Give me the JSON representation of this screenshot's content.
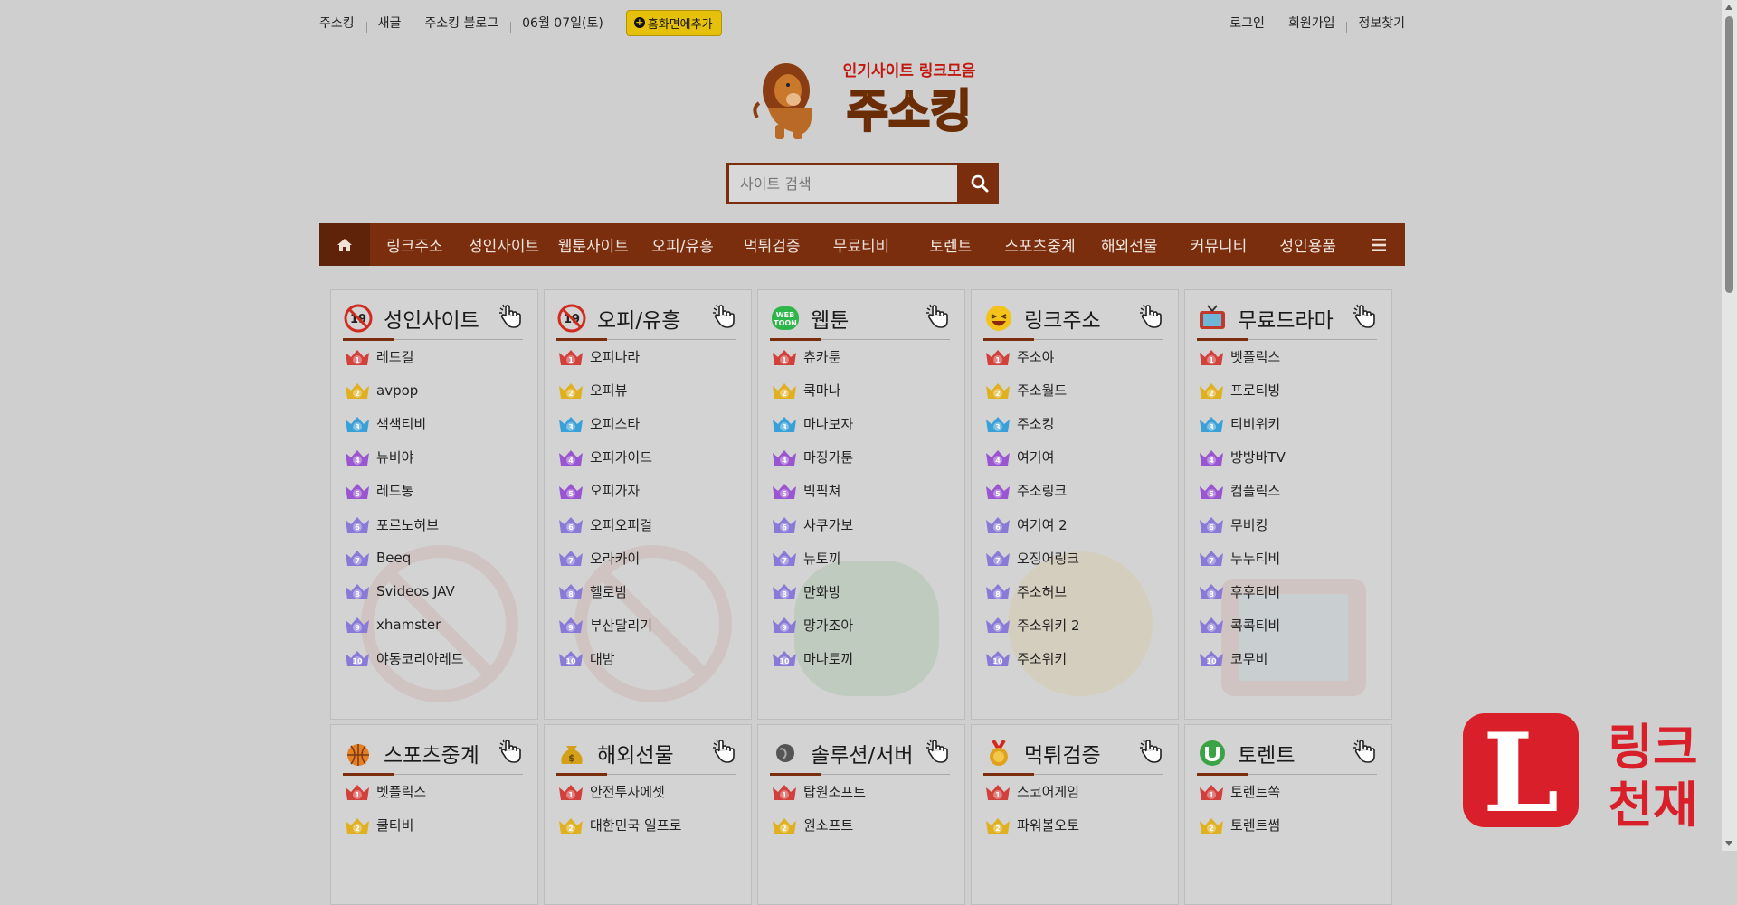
{
  "topbar": {
    "left": [
      "주소킹",
      "새글",
      "주소킹 블로그",
      "06월 07일(토)"
    ],
    "add_home": "홈화면에추가",
    "right": [
      "로그인",
      "회원가입",
      "정보찾기"
    ]
  },
  "logo": {
    "tagline": "인기사이트 링크모음",
    "name": "주소킹"
  },
  "search": {
    "placeholder": "사이트 검색"
  },
  "nav": [
    "링크주소",
    "성인사이트",
    "웹툰사이트",
    "오피/유흥",
    "먹튀검증",
    "무료티비",
    "토렌트",
    "스포츠중계",
    "해외선물",
    "커뮤니티",
    "성인용품"
  ],
  "cards": [
    {
      "title": "성인사이트",
      "icon": "no-19-icon",
      "items": [
        "레드걸",
        "avpop",
        "색색티비",
        "뉴비야",
        "레드통",
        "포르노허브",
        "Beeq",
        "Svideos JAV",
        "xhamster",
        "야동코리아레드"
      ]
    },
    {
      "title": "오피/유흥",
      "icon": "no-19-icon",
      "items": [
        "오피나라",
        "오피뷰",
        "오피스타",
        "오피가이드",
        "오피가자",
        "오피오피걸",
        "오라카이",
        "헬로밤",
        "부산달리기",
        "대밤"
      ]
    },
    {
      "title": "웹툰",
      "icon": "webtoon-icon",
      "items": [
        "츄카툰",
        "쿡마나",
        "마나보자",
        "마징가툰",
        "빅픽쳐",
        "사쿠가보",
        "뉴토끼",
        "만화방",
        "망가조아",
        "마나토끼"
      ]
    },
    {
      "title": "링크주소",
      "icon": "laughing-face-icon",
      "items": [
        "주소야",
        "주소월드",
        "주소킹",
        "여기여",
        "주소링크",
        "여기여 2",
        "오징어링크",
        "주소허브",
        "주소위키 2",
        "주소위키"
      ]
    },
    {
      "title": "무료드라마",
      "icon": "tv-icon",
      "items": [
        "벳플릭스",
        "프로티빙",
        "티비위키",
        "방방바TV",
        "컴플릭스",
        "무비킹",
        "누누티비",
        "후후티비",
        "콕콕티비",
        "코무비"
      ]
    },
    {
      "title": "스포츠중계",
      "icon": "sports-balls-icon",
      "items": [
        "벳플릭스",
        "쿨티비"
      ]
    },
    {
      "title": "해외선물",
      "icon": "money-bag-icon",
      "items": [
        "안전투자에셋",
        "대한민국 일프로"
      ]
    },
    {
      "title": "솔루션/서버",
      "icon": "globe-icon",
      "items": [
        "탑원소프트",
        "원소프트"
      ]
    },
    {
      "title": "먹튀검증",
      "icon": "medal-icon",
      "items": [
        "스코어게임",
        "파워볼오토"
      ]
    },
    {
      "title": "토렌트",
      "icon": "utorrent-icon",
      "items": [
        "토렌트쏙",
        "토렌트썸"
      ]
    }
  ],
  "badge": {
    "letter": "L",
    "line1": "링크",
    "line2": "천재"
  },
  "colors": {
    "brand": "#7a2e0e",
    "brand_dark": "#5f230a",
    "add_home": "#e6c10c",
    "badge_red": "#d9202a"
  }
}
